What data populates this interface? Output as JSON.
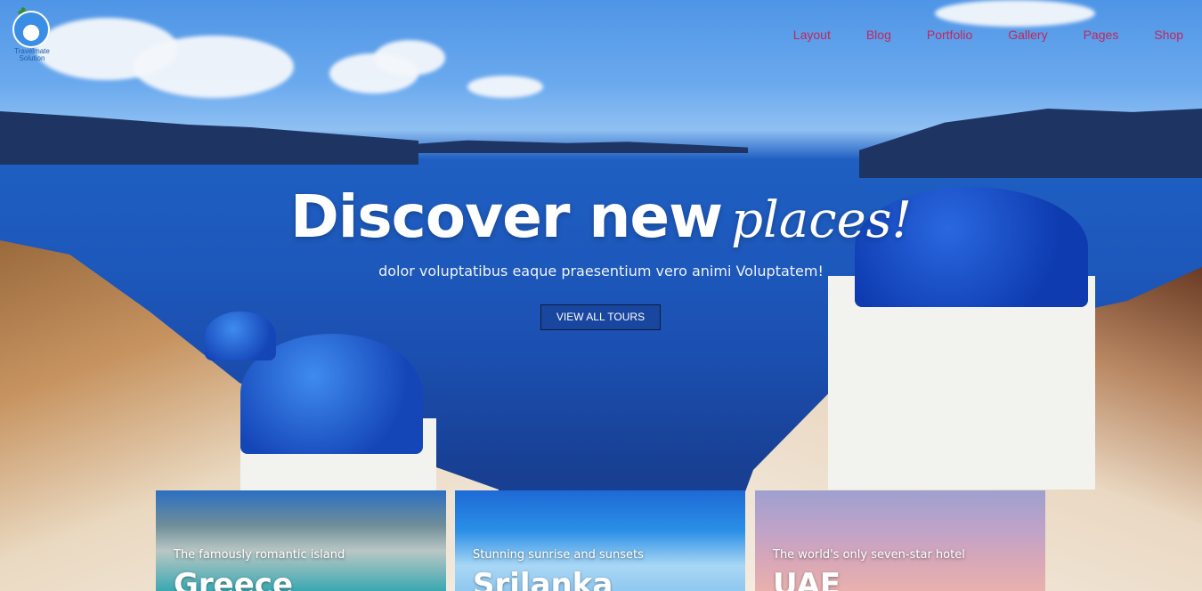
{
  "brand": {
    "logo_text": "Travelmate Solution",
    "logo_icon": "palm-globe-icon"
  },
  "nav": {
    "items": [
      {
        "label": "Layout"
      },
      {
        "label": "Blog"
      },
      {
        "label": "Portfolio"
      },
      {
        "label": "Gallery"
      },
      {
        "label": "Pages"
      },
      {
        "label": "Shop"
      }
    ]
  },
  "hero": {
    "title": "Discover new",
    "title_script": "places!",
    "subtitle": "dolor voluptatibus eaque praesentium vero animi Voluptatem!",
    "cta_label": "VIEW ALL TOURS"
  },
  "cards": [
    {
      "subtitle": "The famously romantic island",
      "title": "Greece"
    },
    {
      "subtitle": "Stunning sunrise and sunsets",
      "title": "Srilanka"
    },
    {
      "subtitle": "The world's only seven-star hotel",
      "title": "UAE"
    }
  ],
  "colors": {
    "nav_link": "#c0285b",
    "cta_border": "#0e1b3b",
    "hero_text": "#ffffff"
  }
}
